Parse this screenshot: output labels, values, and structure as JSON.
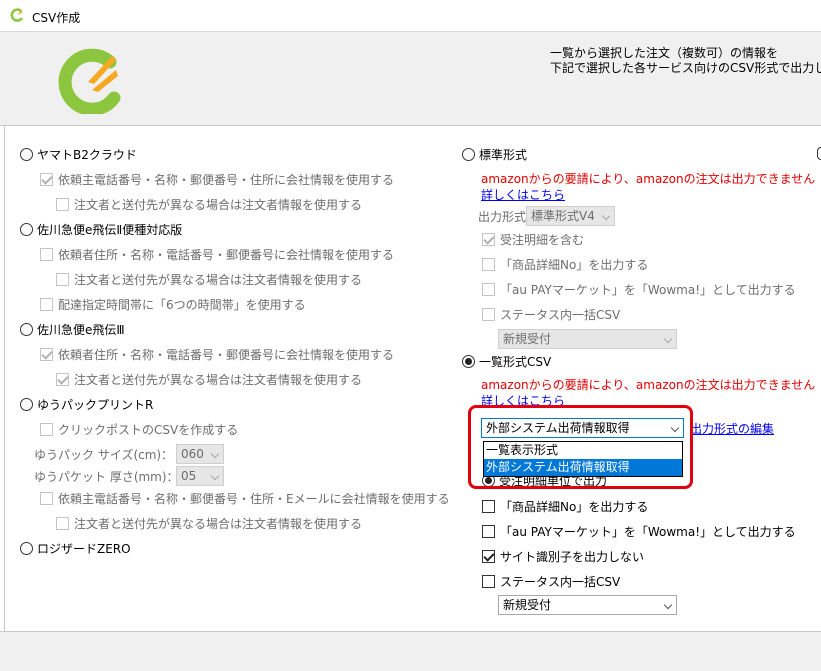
{
  "window": {
    "title": "CSV作成"
  },
  "header": {
    "message_line1": "一覧から選択した注文（複数可）の情報を",
    "message_line2": "下記で選択した各サービス向けのCSV形式で出力し"
  },
  "left": {
    "yamato": {
      "label": "ヤマトB2クラウド",
      "opt1": "依頼主電話番号・名称・郵便番号・住所に会社情報を使用する",
      "opt2": "注文者と送付先が異なる場合は注文者情報を使用する"
    },
    "sagawa2": {
      "label": "佐川急便e飛伝Ⅱ便種対応版",
      "opt1": "依頼者住所・名称・電話番号・郵便番号に会社情報を使用する",
      "opt2": "注文者と送付先が異なる場合は注文者情報を使用する",
      "opt3": "配達指定時間帯に「6つの時間帯」を使用する"
    },
    "sagawa3": {
      "label": "佐川急便e飛伝Ⅲ",
      "opt1": "依頼者住所・名称・電話番号・郵便番号に会社情報を使用する",
      "opt2": "注文者と送付先が異なる場合は注文者情報を使用する"
    },
    "yupack": {
      "label": "ゆうパックプリントR",
      "opt1": "クリックポストのCSVを作成する",
      "size_label": "ゆうパック サイズ(cm)：",
      "size_value": "060",
      "thick_label": "ゆうパケット 厚さ(mm)：",
      "thick_value": "05",
      "opt2": "依頼主電話番号・名称・郵便番号・住所・Eメールに会社情報を使用する",
      "opt3": "注文者と送付先が異なる場合は注文者情報を使用する"
    },
    "logizard": {
      "label": "ロジザードZERO"
    }
  },
  "right": {
    "standard": {
      "label": "標準形式",
      "warning": "amazonからの要請により、amazonの注文は出力できません",
      "link": "詳しくはこちら",
      "format_label": "出力形式",
      "format_value": "標準形式V4",
      "opt1": "受注明細を含む",
      "opt2": "「商品詳細No」を出力する",
      "opt3": "「au PAYマーケット」を「Wowma!」として出力する",
      "opt4": "ステータス内一括CSV",
      "status_value": "新規受付"
    },
    "list": {
      "label": "一覧形式CSV",
      "warning": "amazonからの要請により、amazonの注文は出力できません",
      "link": "詳しくはこちら",
      "format_value": "外部システム出荷情報取得",
      "edit_link": "出力形式の編集",
      "dropdown_options": [
        "一覧表示形式",
        "外部システム出荷情報取得"
      ],
      "unit_label": "受注明細単位で出力",
      "opt2": "「商品詳細No」を出力する",
      "opt3": "「au PAYマーケット」を「Wowma!」として出力する",
      "opt4": "サイト識別子を出力しない",
      "opt5": "ステータス内一括CSV",
      "status_value": "新規受付"
    }
  },
  "colors": {
    "warning": "#e00000",
    "highlight": "#e0000f",
    "selection": "#0078d7",
    "logo_green": "#8cc63f",
    "logo_orange": "#f7a823"
  }
}
